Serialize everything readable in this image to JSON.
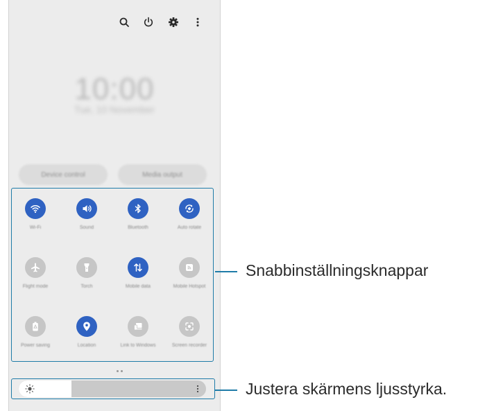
{
  "top_bar": {
    "icons": [
      "search-icon",
      "power-icon",
      "settings-icon",
      "more-icon"
    ]
  },
  "clock": {
    "time": "10:00",
    "date": "Tue, 10 November"
  },
  "buttons": {
    "device_control": "Device control",
    "media_output": "Media output"
  },
  "quick_settings": [
    {
      "label": "Wi-Fi",
      "icon": "wifi-icon",
      "active": true
    },
    {
      "label": "Sound",
      "icon": "sound-icon",
      "active": true
    },
    {
      "label": "Bluetooth",
      "icon": "bluetooth-icon",
      "active": true
    },
    {
      "label": "Auto rotate",
      "icon": "auto-rotate-icon",
      "active": true
    },
    {
      "label": "Flight mode",
      "icon": "airplane-icon",
      "active": false
    },
    {
      "label": "Torch",
      "icon": "torch-icon",
      "active": false
    },
    {
      "label": "Mobile data",
      "icon": "mobile-data-icon",
      "active": true
    },
    {
      "label": "Mobile Hotspot",
      "icon": "hotspot-icon",
      "active": false
    },
    {
      "label": "Power saving",
      "icon": "power-saving-icon",
      "active": false
    },
    {
      "label": "Location",
      "icon": "location-icon",
      "active": true
    },
    {
      "label": "Link to Windows",
      "icon": "link-to-windows-icon",
      "active": false
    },
    {
      "label": "Screen recorder",
      "icon": "screen-recorder-icon",
      "active": false
    }
  ],
  "brightness": {
    "level": 0.28
  },
  "callouts": {
    "quick_settings": "Snabbinställningsknappar",
    "brightness": "Justera skärmens ljusstyrka."
  },
  "colors": {
    "accent": "#2f62c2",
    "frame": "#1e7ba8",
    "panel": "#ececec",
    "inactive": "#c6c6c6"
  }
}
